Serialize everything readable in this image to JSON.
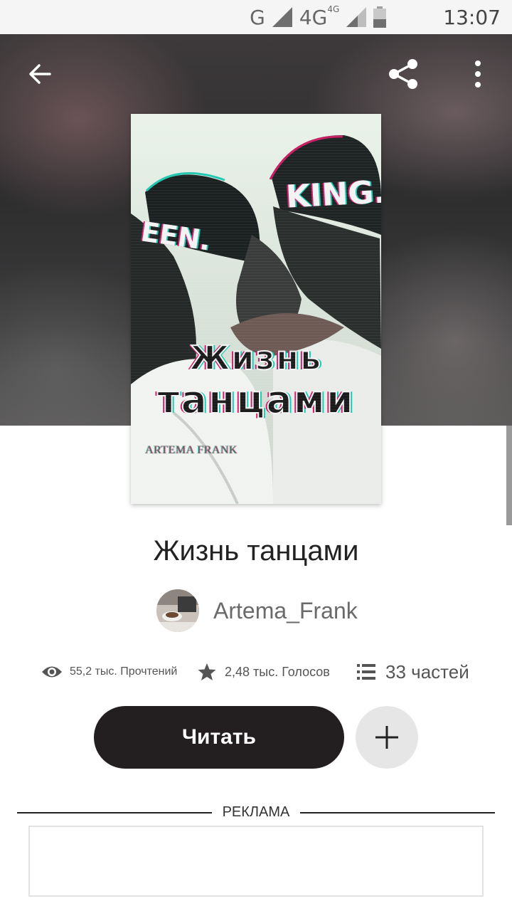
{
  "status_bar": {
    "network1": "G",
    "network2": "4G",
    "network2_sup": "4G",
    "time": "13:07"
  },
  "toolbar": {
    "back_icon": "arrow-left-icon",
    "share_icon": "share-icon",
    "more_icon": "more-vertical-icon"
  },
  "cover": {
    "cap_right": "KING.",
    "cap_left": "EEN.",
    "title_line1": "Жизнь",
    "title_line2": "танцами",
    "author": "ARTEMA FRANK"
  },
  "story": {
    "title": "Жизнь танцами",
    "author": "Artema_Frank"
  },
  "stats": {
    "reads": "55,2 тыс. Прочтений",
    "votes": "2,48 тыс. Голосов",
    "parts": "33 частей"
  },
  "actions": {
    "read_label": "Читать",
    "add_icon": "plus-icon"
  },
  "ad": {
    "label": "РЕКЛАМА"
  },
  "colors": {
    "primary_button": "#231f20",
    "add_button": "#e6e6e6",
    "muted_text": "#6a6a6a"
  }
}
